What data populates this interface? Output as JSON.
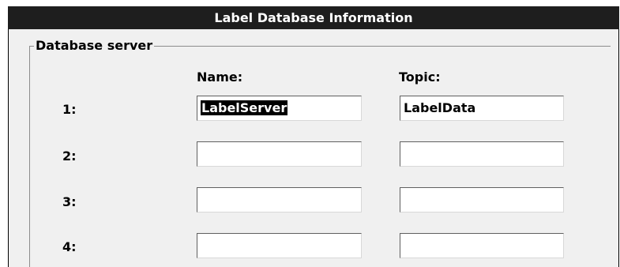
{
  "window": {
    "title": "Label Database Information"
  },
  "group": {
    "legend": "Database server"
  },
  "columns": {
    "name": "Name:",
    "topic": "Topic:"
  },
  "rows": [
    {
      "label": "1:",
      "name": "LabelServer",
      "name_selected": true,
      "topic": "LabelData"
    },
    {
      "label": "2:",
      "name": "",
      "topic": ""
    },
    {
      "label": "3:",
      "name": "",
      "topic": ""
    },
    {
      "label": "4:",
      "name": "",
      "topic": ""
    }
  ]
}
